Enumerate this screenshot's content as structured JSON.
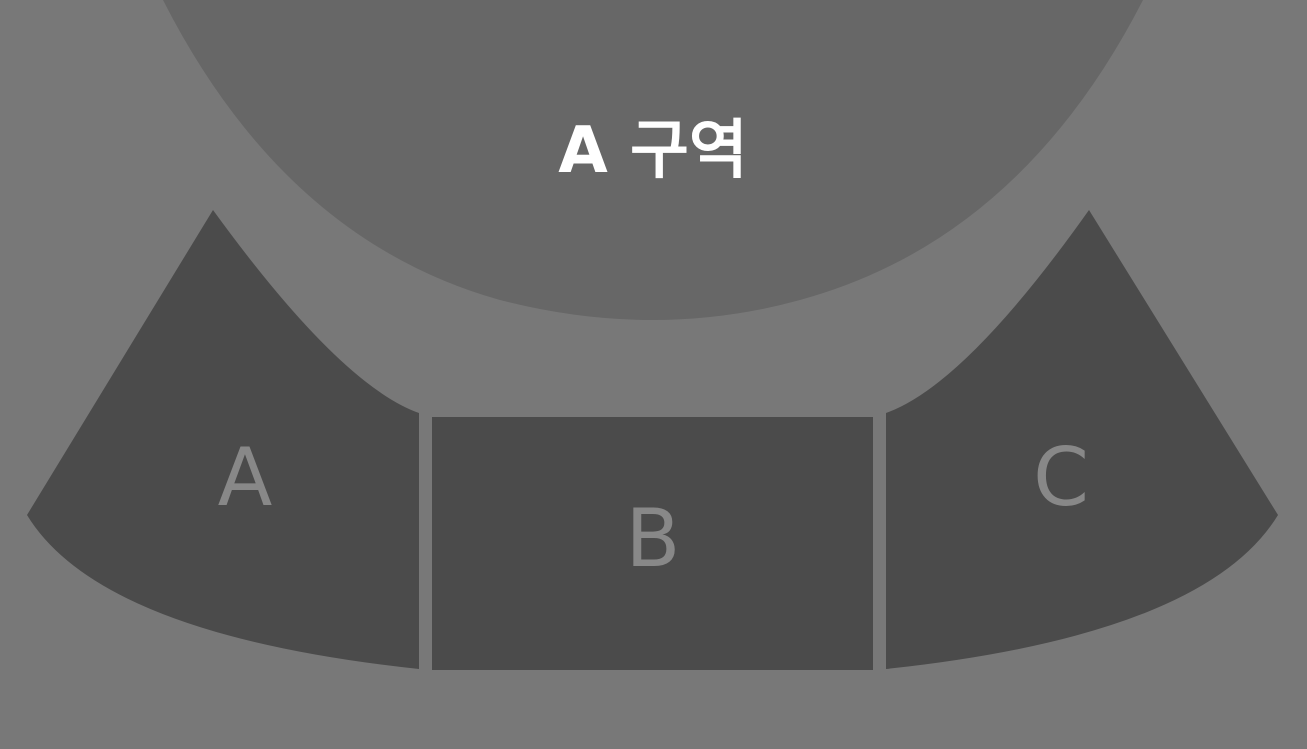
{
  "stage": {
    "label": "A 구역"
  },
  "sections": [
    {
      "id": "a",
      "label": "A"
    },
    {
      "id": "b",
      "label": "B"
    },
    {
      "id": "c",
      "label": "C"
    }
  ],
  "colors": {
    "background": "#787878",
    "stage_fill": "#676767",
    "section_fill": "#4b4b4b",
    "section_label": "#888888",
    "stage_label": "#ffffff"
  }
}
